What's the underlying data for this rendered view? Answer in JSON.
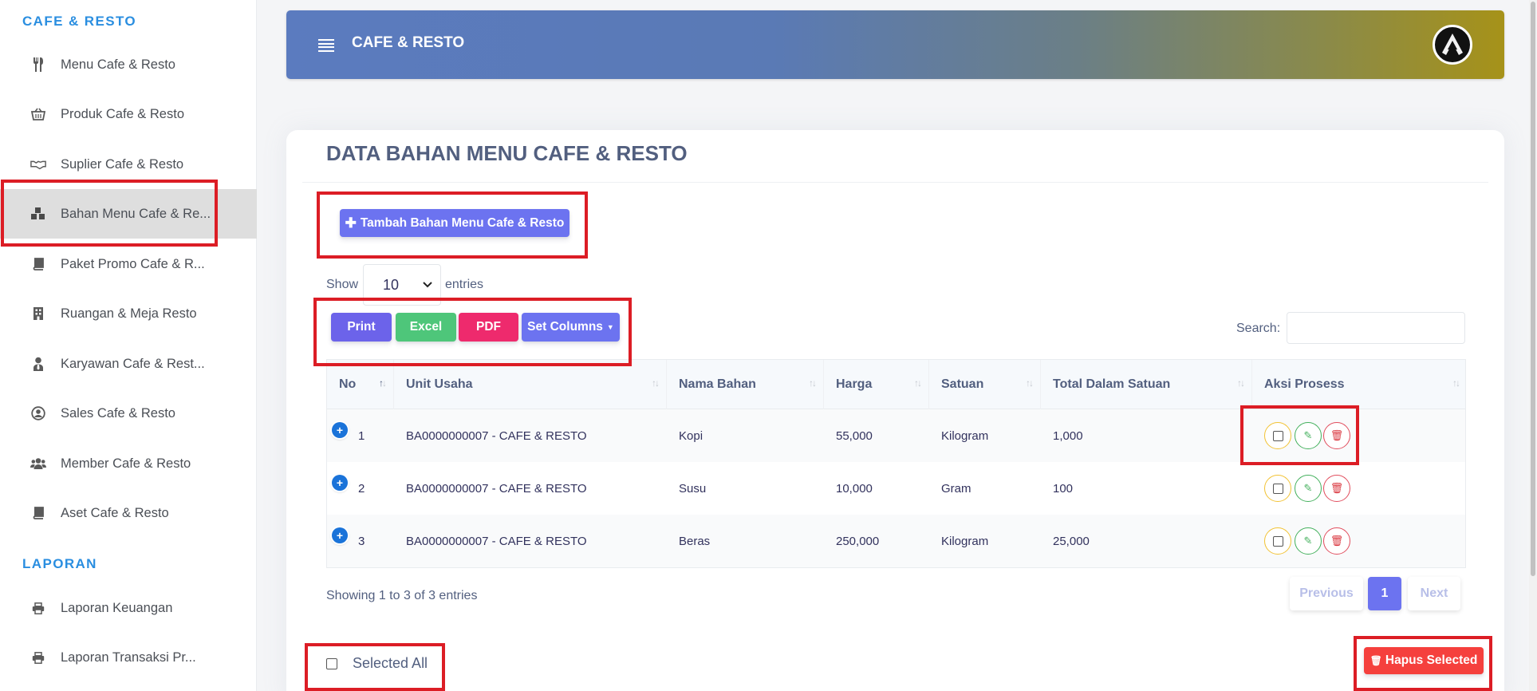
{
  "sidebar": {
    "sections": [
      {
        "title": "CAFE & RESTO",
        "items": [
          {
            "label": "Menu Cafe & Resto",
            "icon": "utensils-icon"
          },
          {
            "label": "Produk Cafe & Resto",
            "icon": "basket-icon"
          },
          {
            "label": "Suplier Cafe & Resto",
            "icon": "handshake-icon"
          },
          {
            "label": "Bahan Menu Cafe & Re...",
            "icon": "cubes-icon",
            "active": true
          },
          {
            "label": "Paket Promo Cafe & R...",
            "icon": "book-icon"
          },
          {
            "label": "Ruangan & Meja Resto",
            "icon": "building-icon"
          },
          {
            "label": "Karyawan Cafe & Rest...",
            "icon": "user-tie-icon"
          },
          {
            "label": "Sales Cafe & Resto",
            "icon": "user-circle-icon"
          },
          {
            "label": "Member Cafe & Resto",
            "icon": "users-icon"
          },
          {
            "label": "Aset Cafe & Resto",
            "icon": "book-icon"
          }
        ]
      },
      {
        "title": "LAPORAN",
        "items": [
          {
            "label": "Laporan Keuangan",
            "icon": "print-icon"
          },
          {
            "label": "Laporan Transaksi Pr...",
            "icon": "print-icon"
          }
        ]
      }
    ]
  },
  "header": {
    "title": "CAFE & RESTO"
  },
  "page": {
    "title": "DATA BAHAN MENU CAFE & RESTO",
    "add_button": "Tambah Bahan Menu Cafe & Resto",
    "show_label": "Show",
    "entries_value": "10",
    "entries_label": "entries",
    "export_buttons": {
      "print": "Print",
      "excel": "Excel",
      "pdf": "PDF",
      "set_columns": "Set Columns"
    },
    "search_label": "Search:",
    "search_value": "",
    "table": {
      "columns": [
        "No",
        "Unit Usaha",
        "Nama Bahan",
        "Harga",
        "Satuan",
        "Total Dalam Satuan",
        "Aksi Prosess"
      ],
      "rows": [
        {
          "no": "1",
          "unit": "BA0000000007 - CAFE & RESTO",
          "nama": "Kopi",
          "harga": "55,000",
          "satuan": "Kilogram",
          "total": "1,000"
        },
        {
          "no": "2",
          "unit": "BA0000000007 - CAFE & RESTO",
          "nama": "Susu",
          "harga": "10,000",
          "satuan": "Gram",
          "total": "100"
        },
        {
          "no": "3",
          "unit": "BA0000000007 - CAFE & RESTO",
          "nama": "Beras",
          "harga": "250,000",
          "satuan": "Kilogram",
          "total": "25,000"
        }
      ]
    },
    "info": "Showing 1 to 3 of 3 entries",
    "pagination": {
      "previous": "Previous",
      "current": "1",
      "next": "Next"
    },
    "select_all_label": "Selected All",
    "delete_selected": "Hapus Selected"
  },
  "colors": {
    "accent": "#6c73f0",
    "highlight": "#dc1d25",
    "section_title": "#2a8ee0"
  }
}
